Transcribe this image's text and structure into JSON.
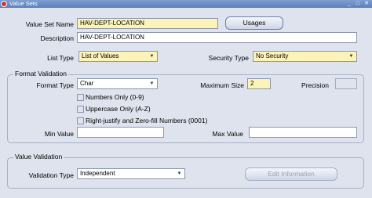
{
  "window": {
    "title": "Value Sets",
    "minimize": "_",
    "maximize": "□",
    "close": "✕"
  },
  "header": {
    "value_set_name_label": "Value Set Name",
    "value_set_name_value": "HAV-DEPT-LOCATION",
    "usages_button": "Usages",
    "description_label": "Description",
    "description_value": "HAV-DEPT-LOCATION",
    "list_type_label": "List Type",
    "list_type_value": "List of Values",
    "security_type_label": "Security Type",
    "security_type_value": "No Security"
  },
  "format_validation": {
    "title": "Format Validation",
    "format_type_label": "Format Type",
    "format_type_value": "Char",
    "max_size_label": "Maximum Size",
    "max_size_value": "2",
    "precision_label": "Precision",
    "precision_value": "",
    "numbers_only": "Numbers Only (0-9)",
    "uppercase_only": "Uppercase Only (A-Z)",
    "right_justify": "Right-justify and Zero-fill Numbers (0001)",
    "min_value_label": "Min Value",
    "min_value": "",
    "max_value_label": "Max Value",
    "max_value": ""
  },
  "value_validation": {
    "title": "Value Validation",
    "validation_type_label": "Validation Type",
    "validation_type_value": "Independent",
    "edit_info_button": "Edit Information"
  },
  "icons": {
    "dropdown": "chevron-down-icon",
    "app": "oracle-icon"
  }
}
